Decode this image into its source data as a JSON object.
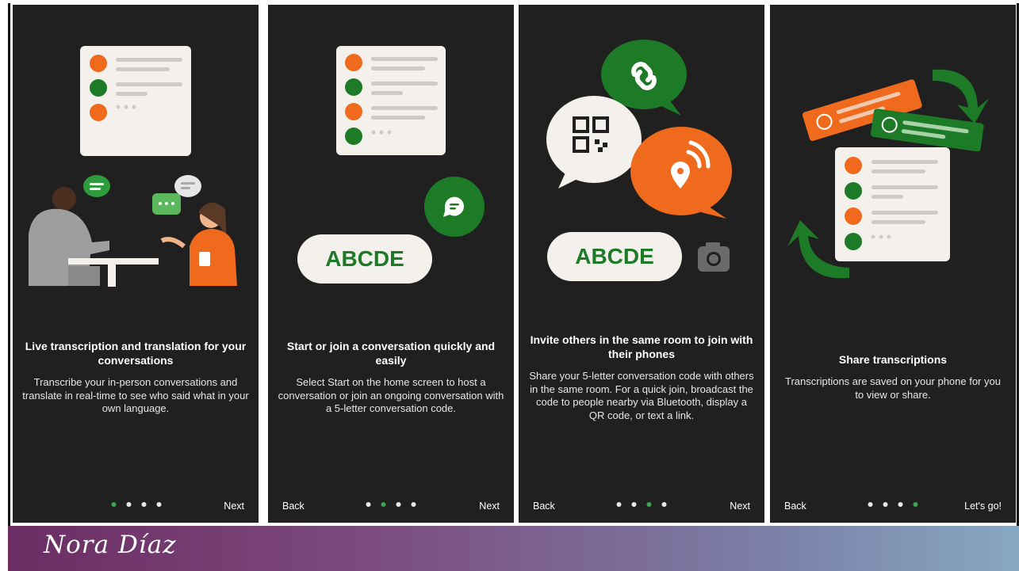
{
  "screens": [
    {
      "title": "Live transcription and translation for your conversations",
      "body": "Transcribe your in-person conversations and translate in real-time to see who said what in your own language.",
      "back": "",
      "next": "Next",
      "active_dot": 1
    },
    {
      "title": "Start or join a conversation quickly and easily",
      "body": "Select Start on the home screen to host a conversation or join an ongoing conversation with a 5-letter conversation code.",
      "back": "Back",
      "next": "Next",
      "code": "ABCDE",
      "active_dot": 2
    },
    {
      "title": "Invite others in the same room to join with their phones",
      "body": "Share your 5-letter conversation code with others in the same room. For a quick join, broadcast the code to people nearby via Bluetooth, display a QR code, or text a link.",
      "back": "Back",
      "next": "Next",
      "code": "ABCDE",
      "active_dot": 3
    },
    {
      "title": "Share transcriptions",
      "body": "Transcriptions are saved on your phone for you to view or share.",
      "back": "Back",
      "next": "Let's go!",
      "active_dot": 4
    }
  ],
  "footer": {
    "signature": "Nora Díaz"
  },
  "colors": {
    "orange": "#ef6a1d",
    "green": "#1d7a26",
    "accent_dot": "#3aa84a",
    "screen_bg": "#202020"
  },
  "icons": [
    "chat-bubble-icon",
    "link-icon",
    "qr-code-icon",
    "broadcast-icon",
    "camera-icon",
    "refresh-arrow-icon"
  ]
}
